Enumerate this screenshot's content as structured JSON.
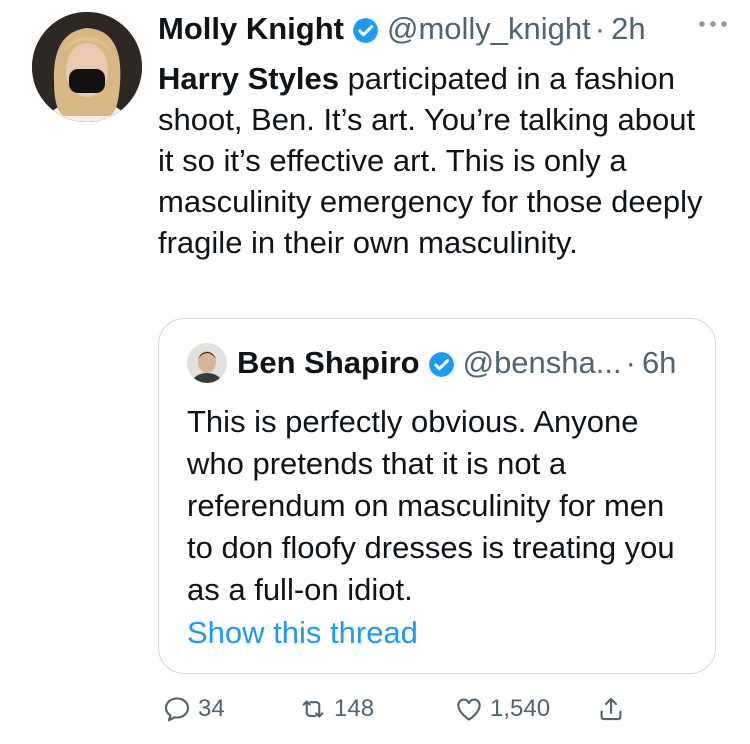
{
  "tweet": {
    "author_name": "Molly Knight",
    "handle": "@molly_knight",
    "separator": "·",
    "time": "2h",
    "text_mention": "Harry Styles",
    "text_rest": " participated in a fashion shoot, Ben. It’s art. You’re talking about it so it’s effective art. This is only a masculinity emergency for those deeply fragile in their own masculinity.",
    "avatar_icon": "profile-photo-masked-woman",
    "verified_icon": "verified-badge",
    "more_icon": "more-dots-icon"
  },
  "quote": {
    "author_name": "Ben Shapiro",
    "handle": "@bensha...",
    "separator": "·",
    "time": "6h",
    "text": "This is perfectly obvious. Anyone who pretends that it is not a referendum on masculinity for men to don floofy dresses is treating you as a full-on idiot.",
    "link_label": "Show this thread"
  },
  "actions": {
    "replies": "34",
    "retweets": "148",
    "likes": "1,540"
  },
  "colors": {
    "accent": "#1d9bf0",
    "secondary_text": "#536471",
    "border": "#cfd9de"
  }
}
